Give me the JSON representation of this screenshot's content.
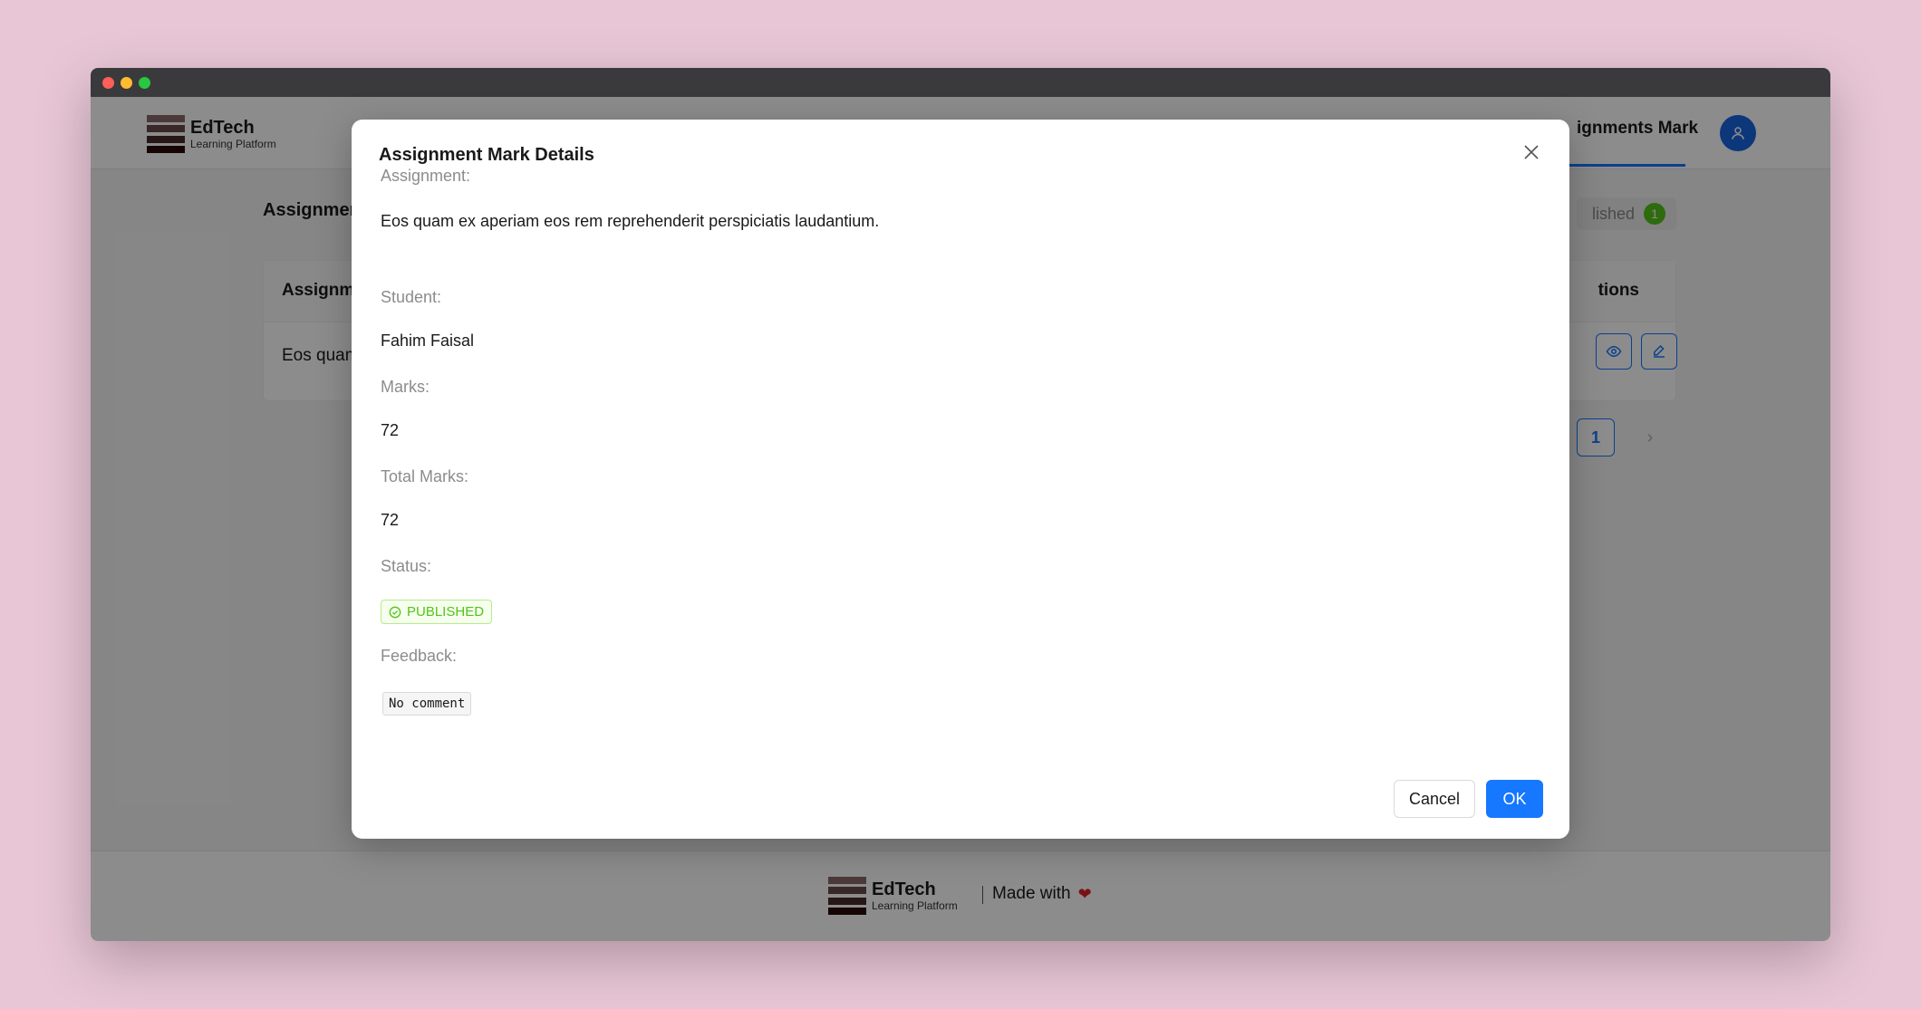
{
  "app": {
    "brand_title": "EdTech",
    "brand_subtitle": "Learning Platform",
    "nav_active": "ignments Mark"
  },
  "page": {
    "heading": "Assignmen",
    "filter_label": "lished",
    "filter_count": "1",
    "table": {
      "header_col1": "Assignme",
      "header_actions": "tions",
      "row_col1": "Eos quam"
    },
    "pagination": {
      "current": "1",
      "next_glyph": "›"
    }
  },
  "footer": {
    "brand_title": "EdTech",
    "brand_subtitle": "Learning Platform",
    "made_with": "Made with",
    "heart": "❤"
  },
  "modal": {
    "title": "Assignment Mark Details",
    "fields": {
      "assignment_label": "Assignment:",
      "assignment_value": "Eos quam ex aperiam eos rem reprehenderit perspiciatis laudantium.",
      "student_label": "Student:",
      "student_value": "Fahim Faisal",
      "marks_label": "Marks:",
      "marks_value": "72",
      "total_label": "Total Marks:",
      "total_value": "72",
      "status_label": "Status:",
      "status_value": "PUBLISHED",
      "feedback_label": "Feedback:",
      "feedback_value": "No comment"
    },
    "cancel_label": "Cancel",
    "ok_label": "OK"
  },
  "colors": {
    "accent": "#1677ff",
    "success": "#52c41a",
    "background": "#e8c6d6"
  }
}
